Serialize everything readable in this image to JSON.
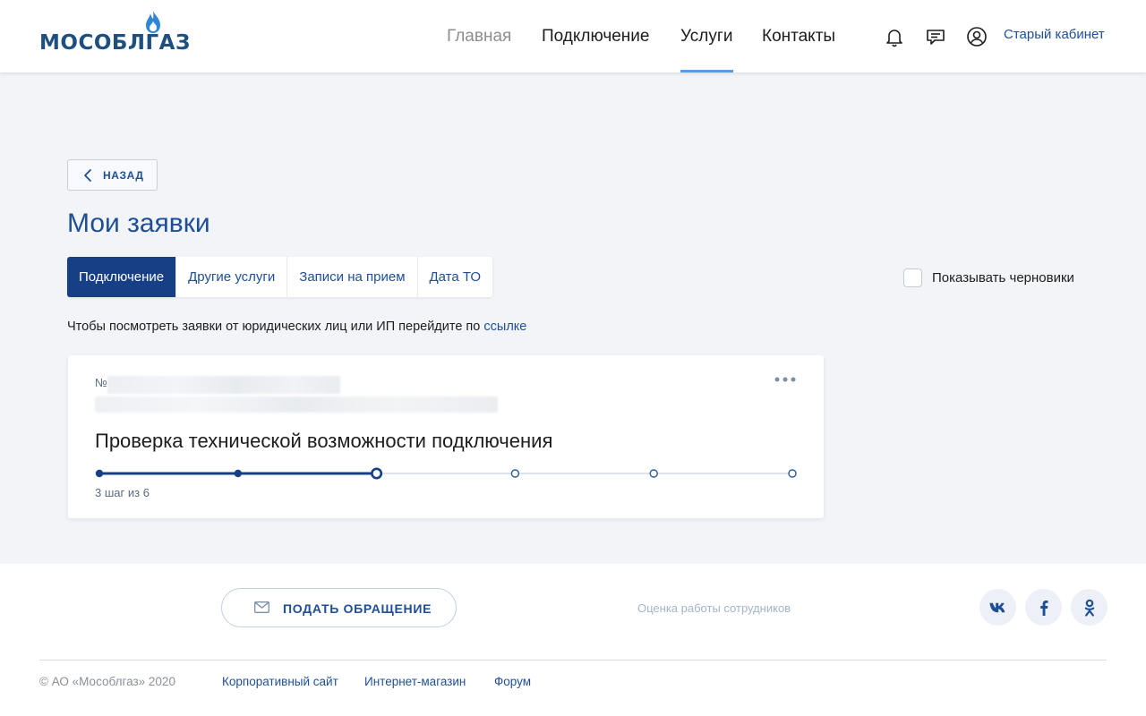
{
  "header": {
    "logo_text": "МОСОБЛГАЗ",
    "nav": [
      {
        "label": "Главная",
        "state": "muted"
      },
      {
        "label": "Подключение",
        "state": "normal"
      },
      {
        "label": "Услуги",
        "state": "active"
      },
      {
        "label": "Контакты",
        "state": "normal"
      }
    ],
    "icons": [
      "bell-icon",
      "chat-icon",
      "user-icon"
    ],
    "old_cabinet_label": "Старый кабинет"
  },
  "main": {
    "back_label": "НАЗАД",
    "title": "Мои заявки",
    "tabs": [
      {
        "label": "Подключение",
        "active": true
      },
      {
        "label": "Другие услуги",
        "active": false
      },
      {
        "label": "Записи на прием",
        "active": false
      },
      {
        "label": "Дата ТО",
        "active": false
      }
    ],
    "show_drafts_label": "Показывать черновики",
    "show_drafts_checked": false,
    "info_text": "Чтобы посмотреть заявки от юридических лиц или ИП перейдите по",
    "info_link": "ссылке",
    "request_card": {
      "number_prefix": "№",
      "title": "Проверка технической возможности подключения",
      "current_step": 3,
      "total_steps": 6,
      "step_label": "3 шаг из 6"
    }
  },
  "footer": {
    "appeal_label": "ПОДАТЬ ОБРАЩЕНИЕ",
    "rating_label": "Оценка работы сотрудников",
    "social": [
      "vk-icon",
      "facebook-icon",
      "odnoklassniki-icon"
    ],
    "copyright": "© АО «Мособлгаз» 2020",
    "links": [
      "Корпоративный сайт",
      "Интернет-магазин",
      "Форум"
    ]
  },
  "colors": {
    "brand_blue": "#1e4f96",
    "active_tab": "#173f86",
    "nav_underline": "#5c9be0",
    "page_bg": "#f2f4f8"
  }
}
